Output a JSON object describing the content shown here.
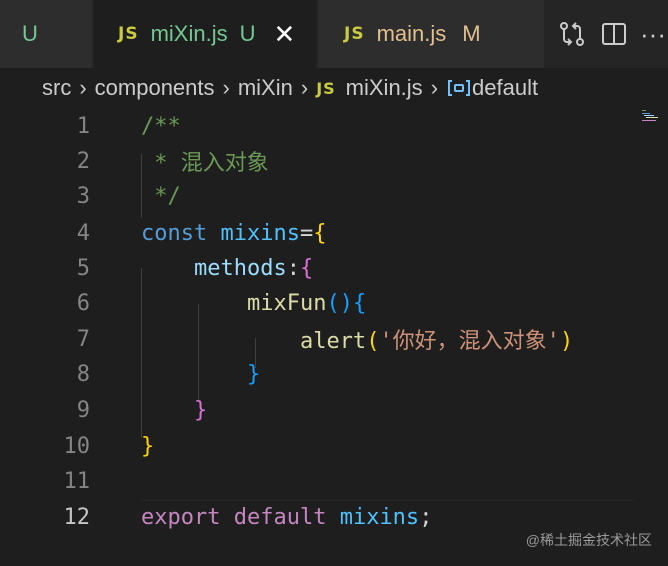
{
  "tabs": [
    {
      "name": "",
      "status": "U"
    },
    {
      "icon": "JS",
      "name": "miXin.js",
      "status": "U",
      "close": "✕"
    },
    {
      "icon": "JS",
      "name": "main.js",
      "status": "M"
    }
  ],
  "actions": {
    "more": "···"
  },
  "breadcrumb": [
    "src",
    "components",
    "miXin",
    "miXin.js",
    "default"
  ],
  "breadcrumb_js_icon": "JS",
  "code_lines": [
    {
      "n": "1",
      "text": "/**"
    },
    {
      "n": "2",
      "text": " * 混入对象"
    },
    {
      "n": "3",
      "text": " */"
    },
    {
      "n": "4",
      "text": "const mixins={"
    },
    {
      "n": "5",
      "text": "    methods:{"
    },
    {
      "n": "6",
      "text": "        mixFun(){"
    },
    {
      "n": "7",
      "text": "            alert('你好，混入对象')"
    },
    {
      "n": "8",
      "text": "        }"
    },
    {
      "n": "9",
      "text": "    }"
    },
    {
      "n": "10",
      "text": "}"
    },
    {
      "n": "11",
      "text": ""
    },
    {
      "n": "12",
      "text": "export default mixins;"
    }
  ],
  "tokens": {
    "l1": "/**",
    "l2": " * 混入对象",
    "l3": " */",
    "l4_kw": "const",
    "l4_var": "mixins",
    "l4_eq": "=",
    "l4_br": "{",
    "l5_prop": "methods",
    "l5_colon": ":",
    "l5_br": "{",
    "l6_fn": "mixFun",
    "l6_paren": "()",
    "l6_br": "{",
    "l7_fn": "alert",
    "l7_open": "(",
    "l7_str": "'你好，混入对象'",
    "l7_close": ")",
    "l8_br": "}",
    "l9_br": "}",
    "l10_br": "}",
    "l12_kw1": "export",
    "l12_kw2": "default",
    "l12_var": "mixins",
    "l12_semi": ";"
  },
  "watermark": "@稀土掘金技术社区",
  "colors": {
    "bg": "#1e1e1e",
    "tabbar": "#252526",
    "untracked": "#73c991",
    "modified": "#e2c08d",
    "js": "#cbcb41"
  }
}
